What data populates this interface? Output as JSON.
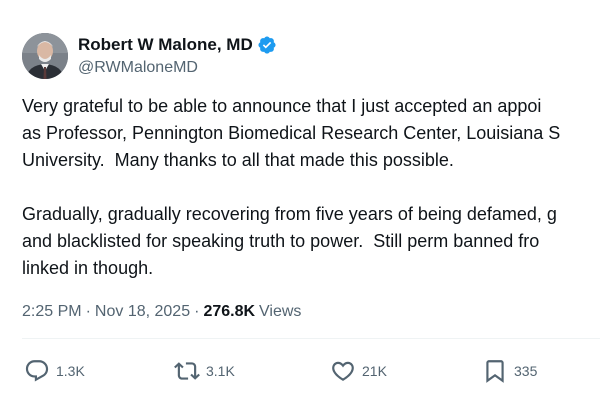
{
  "author": {
    "display_name": "Robert W Malone, MD",
    "handle": "@RWMaloneMD"
  },
  "icons": {
    "verified": "verified-badge-icon",
    "reply": "reply-icon",
    "retweet": "retweet-icon",
    "like": "heart-icon",
    "bookmark": "bookmark-icon"
  },
  "colors": {
    "verified": "#1d9bf0",
    "text_primary": "#0f1419",
    "text_secondary": "#536471"
  },
  "tweet": {
    "paragraphs": [
      {
        "lines": [
          "Very grateful to be able to announce that I just accepted an appoi",
          "as Professor, Pennington Biomedical Research Center, Louisiana S",
          "University.  Many thanks to all that made this possible."
        ]
      },
      {
        "lines": [
          "Gradually, gradually recovering from five years of being defamed, g",
          "and blacklisted for speaking truth to power.  Still perm banned fro",
          "linked in though."
        ]
      }
    ],
    "time": "2:25 PM",
    "date": "Nov 18, 2025",
    "separator": "·",
    "views_count": "276.8K",
    "views_label": "Views"
  },
  "actions": {
    "replies": "1.3K",
    "retweets": "3.1K",
    "likes": "21K",
    "bookmarks": "335"
  }
}
